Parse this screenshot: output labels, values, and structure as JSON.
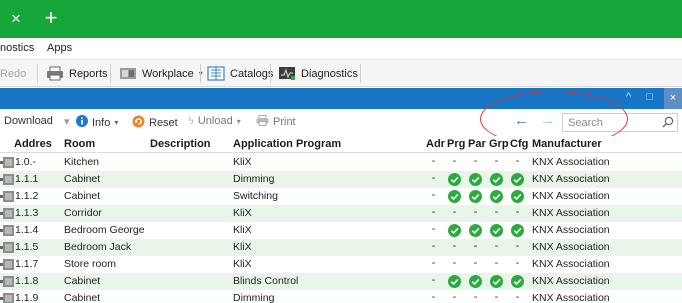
{
  "tabbar": {
    "close_glyph": "×",
    "add_glyph": "+"
  },
  "menu": {
    "items": [
      "nostics",
      "Apps"
    ]
  },
  "toolbar": {
    "redo_label": "Redo",
    "reports_label": "Reports",
    "workplace_label": "Workplace",
    "catalogs_label": "Catalogs",
    "diagnostics_label": "Diagnostics"
  },
  "subbar": {
    "download_label": "Download",
    "info_label": "Info",
    "reset_label": "Reset",
    "unload_label": "Unload",
    "print_label": "Print",
    "search_placeholder": "Search"
  },
  "table": {
    "columns": [
      "Addres",
      "Room",
      "Description",
      "Application Program",
      "Adr",
      "Prg",
      "Par",
      "Grp",
      "Cfg",
      "Manufacturer"
    ],
    "rows": [
      {
        "address": "1.0.-",
        "room": "Kitchen",
        "description": "",
        "program": "KliX",
        "flags": [
          "-",
          "-",
          "-",
          "-",
          "-"
        ],
        "manufacturer": "KNX Association"
      },
      {
        "address": "1.1.1",
        "room": "Cabinet",
        "description": "",
        "program": "Dimming",
        "flags": [
          "-",
          "ok",
          "ok",
          "ok",
          "ok"
        ],
        "manufacturer": "KNX Association"
      },
      {
        "address": "1.1.2",
        "room": "Cabinet",
        "description": "",
        "program": "Switching",
        "flags": [
          "-",
          "ok",
          "ok",
          "ok",
          "ok"
        ],
        "manufacturer": "KNX Association"
      },
      {
        "address": "1.1.3",
        "room": "Corridor",
        "description": "",
        "program": "KliX",
        "flags": [
          "-",
          "-",
          "-",
          "-",
          "-"
        ],
        "manufacturer": "KNX Association"
      },
      {
        "address": "1.1.4",
        "room": "Bedroom George",
        "description": "",
        "program": "KliX",
        "flags": [
          "-",
          "ok",
          "ok",
          "ok",
          "ok"
        ],
        "manufacturer": "KNX Association"
      },
      {
        "address": "1.1.5",
        "room": "Bedroom Jack",
        "description": "",
        "program": "KliX",
        "flags": [
          "-",
          "-",
          "-",
          "-",
          "-"
        ],
        "manufacturer": "KNX Association"
      },
      {
        "address": "1.1.7",
        "room": "Store room",
        "description": "",
        "program": "KliX",
        "flags": [
          "-",
          "-",
          "-",
          "-",
          "-"
        ],
        "manufacturer": "KNX Association"
      },
      {
        "address": "1.1.8",
        "room": "Cabinet",
        "description": "",
        "program": "Blinds Control",
        "flags": [
          "-",
          "ok",
          "ok",
          "ok",
          "ok"
        ],
        "manufacturer": "KNX Association"
      },
      {
        "address": "1.1.9",
        "room": "Cabinet",
        "description": "",
        "program": "Dimming",
        "flags": [
          "-",
          "-",
          "-",
          "-",
          "-"
        ],
        "manufacturer": "KNX Association"
      }
    ]
  },
  "colors": {
    "tabbar": "#16a63a",
    "headerband": "#1776c8",
    "row_alt": "#eaf5ea",
    "check": "#2bab3f",
    "annotation": "#e0312f",
    "nav_arrow": "#2c7fd4"
  }
}
